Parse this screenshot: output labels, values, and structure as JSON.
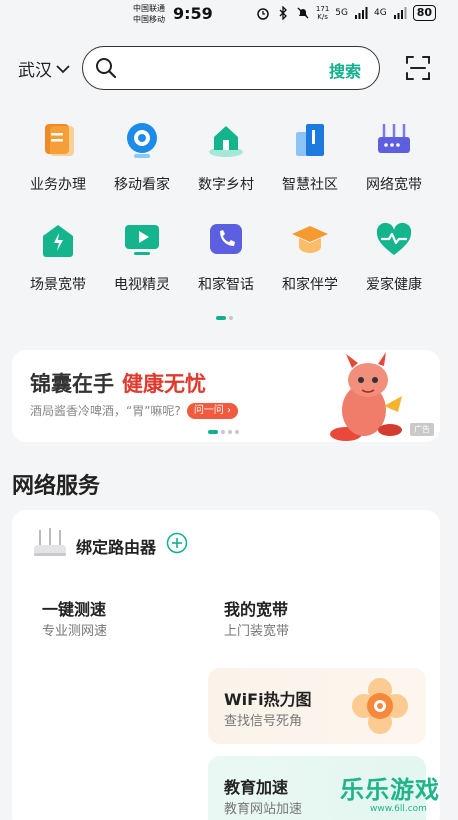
{
  "status_bar": {
    "carrier1": "中国联通",
    "carrier2": "中国移动",
    "time": "9:59",
    "speed_value": "171",
    "speed_unit": "K/s",
    "network1": "5G",
    "network2": "4G",
    "battery": "80"
  },
  "header": {
    "city": "武汉",
    "search_placeholder": "",
    "search_button": "搜索"
  },
  "grid": {
    "row1": [
      {
        "label": "业务办理",
        "icon": "business-icon"
      },
      {
        "label": "移动看家",
        "icon": "camera-icon"
      },
      {
        "label": "数字乡村",
        "icon": "village-icon"
      },
      {
        "label": "智慧社区",
        "icon": "community-icon"
      },
      {
        "label": "网络宽带",
        "icon": "router-icon"
      }
    ],
    "row2": [
      {
        "label": "场景宽带",
        "icon": "scene-broadband-icon"
      },
      {
        "label": "电视精灵",
        "icon": "tv-icon"
      },
      {
        "label": "和家智话",
        "icon": "phone-icon"
      },
      {
        "label": "和家伴学",
        "icon": "graduation-cap-icon"
      },
      {
        "label": "爱家健康",
        "icon": "health-heart-icon"
      }
    ]
  },
  "banner": {
    "title_part1": "锦囊在手",
    "title_part2": "健康无忧",
    "subtitle": "酒局酱香冷啤酒，“胃”嘛呢?",
    "ask_button": "问一问 ›",
    "ad_tag": "广告"
  },
  "section": {
    "title": "网络服务",
    "bind_router": "绑定路由器",
    "speed_test_title": "一键测速",
    "speed_test_sub": "专业测网速",
    "my_broadband_title": "我的宽带",
    "my_broadband_sub": "上门装宽带",
    "wifi_title": "WiFi热力图",
    "wifi_sub": "查找信号死角",
    "edu_title": "教育加速",
    "edu_sub": "教育网站加速"
  },
  "watermark": {
    "text": "乐乐游戏",
    "url": "www.6ll.com"
  },
  "colors": {
    "accent": "#12b08e",
    "banner_red": "#e03a2e"
  }
}
